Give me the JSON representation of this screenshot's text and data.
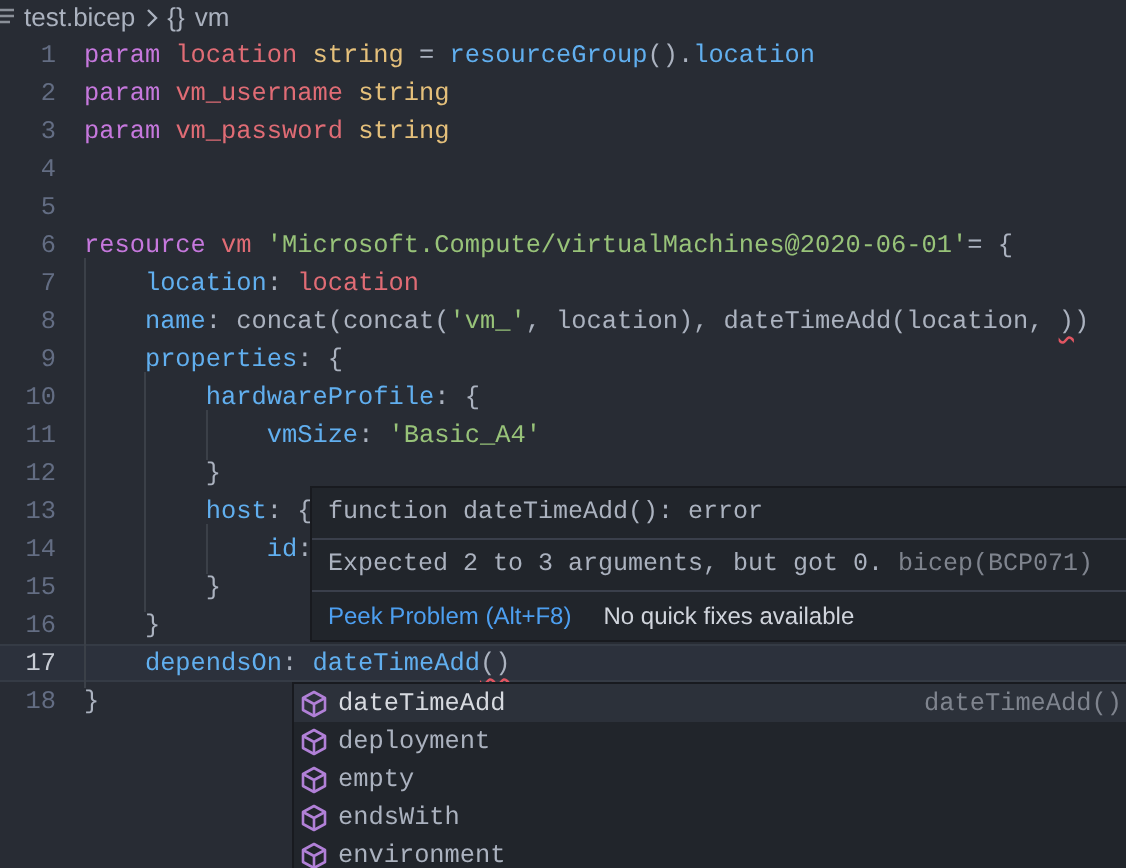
{
  "breadcrumb": {
    "file": "test.bicep",
    "symbol_glyph": "{}",
    "symbol": "vm"
  },
  "lines": [
    {
      "number": "1",
      "current": false,
      "tokens": [
        {
          "text": "param",
          "kind": "keyword"
        },
        {
          "text": " location",
          "kind": "variable"
        },
        {
          "text": " string",
          "kind": "type"
        },
        {
          "text": " = ",
          "kind": "plain"
        },
        {
          "text": "resourceGroup",
          "kind": "function"
        },
        {
          "text": "().",
          "kind": "plain"
        },
        {
          "text": "location",
          "kind": "property"
        }
      ]
    },
    {
      "number": "2",
      "current": false,
      "tokens": [
        {
          "text": "param",
          "kind": "keyword"
        },
        {
          "text": " vm_username",
          "kind": "variable"
        },
        {
          "text": " string",
          "kind": "type"
        }
      ]
    },
    {
      "number": "3",
      "current": false,
      "tokens": [
        {
          "text": "param",
          "kind": "keyword"
        },
        {
          "text": " vm_password",
          "kind": "variable"
        },
        {
          "text": " string",
          "kind": "type"
        }
      ]
    },
    {
      "number": "4",
      "current": false
    },
    {
      "number": "5",
      "current": false
    },
    {
      "number": "6",
      "current": false,
      "tokens": [
        {
          "text": "resource",
          "kind": "keyword"
        },
        {
          "text": " vm",
          "kind": "variable"
        },
        {
          "text": " 'Microsoft.Compute/virtualMachines@2020-06-01'",
          "kind": "string"
        },
        {
          "text": "= {",
          "kind": "plain"
        }
      ]
    },
    {
      "number": "7",
      "current": false,
      "tokens": [
        {
          "text": "    location",
          "kind": "property"
        },
        {
          "text": ": ",
          "kind": "plain"
        },
        {
          "text": "location",
          "kind": "variable"
        }
      ]
    },
    {
      "number": "8",
      "current": false,
      "tokens": [
        {
          "text": "    name",
          "kind": "property"
        },
        {
          "text": ": concat(concat(",
          "kind": "plain"
        },
        {
          "text": "'vm_'",
          "kind": "string"
        },
        {
          "text": ", location), dateTimeAdd(location, ",
          "kind": "plain"
        },
        {
          "text": ")",
          "kind": "plain",
          "error": true
        },
        {
          "text": ")",
          "kind": "plain"
        }
      ]
    },
    {
      "number": "9",
      "current": false,
      "tokens": [
        {
          "text": "    properties",
          "kind": "property"
        },
        {
          "text": ": {",
          "kind": "plain"
        }
      ]
    },
    {
      "number": "10",
      "current": false,
      "tokens": [
        {
          "text": "        hardwareProfile",
          "kind": "property"
        },
        {
          "text": ": {",
          "kind": "plain"
        }
      ]
    },
    {
      "number": "11",
      "current": false,
      "tokens": [
        {
          "text": "            vmSize",
          "kind": "property"
        },
        {
          "text": ": ",
          "kind": "plain"
        },
        {
          "text": "'Basic_A4'",
          "kind": "string"
        }
      ]
    },
    {
      "number": "12",
      "current": false,
      "tokens": [
        {
          "text": "        }",
          "kind": "plain"
        }
      ]
    },
    {
      "number": "13",
      "current": false,
      "tokens": [
        {
          "text": "        host",
          "kind": "property"
        },
        {
          "text": ": {",
          "kind": "plain"
        }
      ]
    },
    {
      "number": "14",
      "current": false,
      "tokens": [
        {
          "text": "            id",
          "kind": "property"
        },
        {
          "text": ":",
          "kind": "plain"
        }
      ]
    },
    {
      "number": "15",
      "current": false,
      "tokens": [
        {
          "text": "        }",
          "kind": "plain"
        }
      ]
    },
    {
      "number": "16",
      "current": false,
      "tokens": [
        {
          "text": "    }",
          "kind": "plain"
        }
      ]
    },
    {
      "number": "17",
      "current": true,
      "tokens": [
        {
          "text": "    dependsOn",
          "kind": "property"
        },
        {
          "text": ": ",
          "kind": "plain"
        },
        {
          "text": "dateTimeAdd",
          "kind": "function"
        },
        {
          "text": "()",
          "kind": "plain",
          "error": true
        }
      ]
    },
    {
      "number": "18",
      "current": false,
      "tokens": [
        {
          "text": "}",
          "kind": "plain"
        }
      ]
    }
  ],
  "hover": {
    "signature": "function dateTimeAdd(): error",
    "message": "Expected 2 to 3 arguments, but got 0.",
    "source": "bicep(BCP071)",
    "peek_link": "Peek Problem (Alt+F8)",
    "quick_fix_note": "No quick fixes available"
  },
  "suggestions": [
    {
      "label": "dateTimeAdd",
      "detail": "dateTimeAdd()",
      "selected": true
    },
    {
      "label": "deployment",
      "selected": false
    },
    {
      "label": "empty",
      "selected": false
    },
    {
      "label": "endsWith",
      "selected": false
    },
    {
      "label": "environment",
      "selected": false
    }
  ]
}
